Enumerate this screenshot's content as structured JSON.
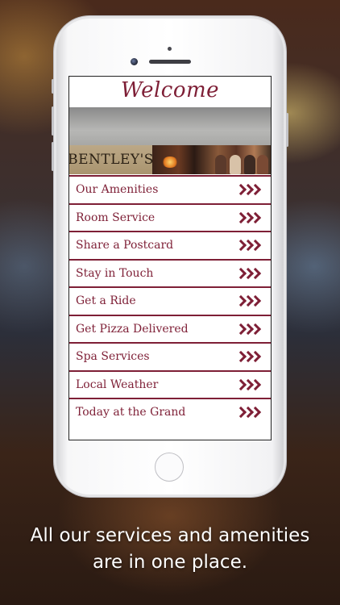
{
  "header": {
    "title": "Welcome"
  },
  "banner": {
    "logo_text": "BENTLEY'S"
  },
  "menu": {
    "items": [
      {
        "label": "Our Amenities"
      },
      {
        "label": "Room Service"
      },
      {
        "label": "Share a Postcard"
      },
      {
        "label": "Stay in Touch"
      },
      {
        "label": "Get a Ride"
      },
      {
        "label": "Get Pizza Delivered"
      },
      {
        "label": "Spa Services"
      },
      {
        "label": "Local Weather"
      },
      {
        "label": "Today at the Grand"
      }
    ]
  },
  "caption": {
    "line1": "All our services and amenities",
    "line2": "are in one place."
  },
  "colors": {
    "accent": "#7e1f36",
    "background": "#ffffff"
  },
  "icons": {
    "row_arrow": "triple-chevron-right-icon"
  }
}
